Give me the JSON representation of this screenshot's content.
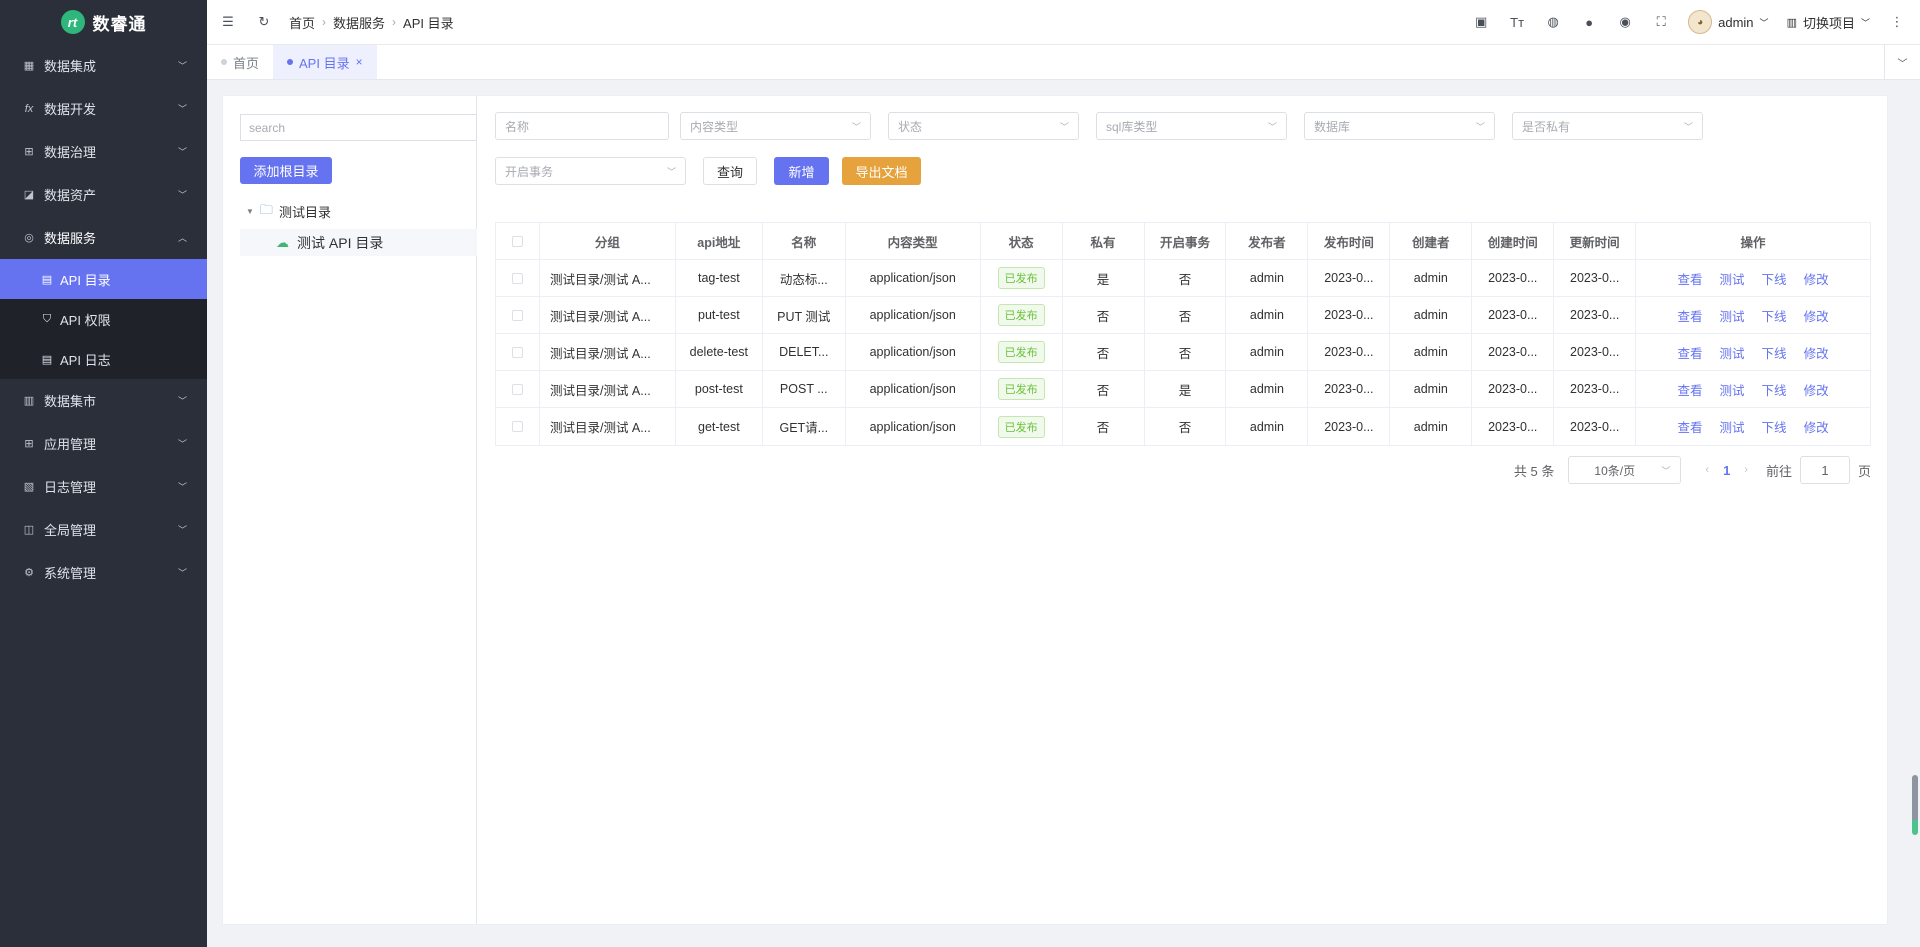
{
  "app": {
    "logo_mark": "rt",
    "name": "数睿通"
  },
  "sidebar": {
    "items": [
      {
        "label": "数据集成",
        "icon": "integration-icon"
      },
      {
        "label": "数据开发",
        "icon": "fx-icon"
      },
      {
        "label": "数据治理",
        "icon": "grid-icon"
      },
      {
        "label": "数据资产",
        "icon": "asset-icon"
      },
      {
        "label": "数据服务",
        "icon": "service-icon"
      },
      {
        "label": "数据集市",
        "icon": "market-icon"
      },
      {
        "label": "应用管理",
        "icon": "app-icon"
      },
      {
        "label": "日志管理",
        "icon": "log-icon"
      },
      {
        "label": "全局管理",
        "icon": "global-icon"
      },
      {
        "label": "系统管理",
        "icon": "gear-icon"
      }
    ],
    "sub_items": [
      {
        "label": "API 目录",
        "active": true
      },
      {
        "label": "API 权限",
        "active": false
      },
      {
        "label": "API 日志",
        "active": false
      }
    ]
  },
  "header": {
    "breadcrumb": [
      "首页",
      "数据服务",
      "API 目录"
    ],
    "user": "admin",
    "project_switch": "切换项目"
  },
  "tabs": [
    {
      "label": "首页",
      "active": false
    },
    {
      "label": "API 目录",
      "active": true,
      "close": "×"
    }
  ],
  "tree": {
    "search_placeholder": "search",
    "add_root_label": "添加根目录",
    "root": "测试目录",
    "child": "测试 API 目录"
  },
  "filters": {
    "name_placeholder": "名称",
    "content_type_placeholder": "内容类型",
    "status_placeholder": "状态",
    "sql_type_placeholder": "sql库类型",
    "database_placeholder": "数据库",
    "private_placeholder": "是否私有",
    "transaction_placeholder": "开启事务",
    "query_label": "查询",
    "new_label": "新增",
    "export_label": "导出文档"
  },
  "table": {
    "columns": [
      "分组",
      "api地址",
      "名称",
      "内容类型",
      "状态",
      "私有",
      "开启事务",
      "发布者",
      "发布时间",
      "创建者",
      "创建时间",
      "更新时间",
      "操作"
    ],
    "rows": [
      {
        "group": "测试目录/测试 A...",
        "path": "tag-test",
        "name": "动态标...",
        "content_type": "application/json",
        "status": "已发布",
        "private": "是",
        "transaction": "否",
        "publisher": "admin",
        "publish_time": "2023-0...",
        "creator": "admin",
        "create_time": "2023-0...",
        "update_time": "2023-0..."
      },
      {
        "group": "测试目录/测试 A...",
        "path": "put-test",
        "name": "PUT 测试",
        "content_type": "application/json",
        "status": "已发布",
        "private": "否",
        "transaction": "否",
        "publisher": "admin",
        "publish_time": "2023-0...",
        "creator": "admin",
        "create_time": "2023-0...",
        "update_time": "2023-0..."
      },
      {
        "group": "测试目录/测试 A...",
        "path": "delete-test",
        "name": "DELET...",
        "content_type": "application/json",
        "status": "已发布",
        "private": "否",
        "transaction": "否",
        "publisher": "admin",
        "publish_time": "2023-0...",
        "creator": "admin",
        "create_time": "2023-0...",
        "update_time": "2023-0..."
      },
      {
        "group": "测试目录/测试 A...",
        "path": "post-test",
        "name": "POST ...",
        "content_type": "application/json",
        "status": "已发布",
        "private": "否",
        "transaction": "是",
        "publisher": "admin",
        "publish_time": "2023-0...",
        "creator": "admin",
        "create_time": "2023-0...",
        "update_time": "2023-0..."
      },
      {
        "group": "测试目录/测试 A...",
        "path": "get-test",
        "name": "GET请...",
        "content_type": "application/json",
        "status": "已发布",
        "private": "否",
        "transaction": "否",
        "publisher": "admin",
        "publish_time": "2023-0...",
        "creator": "admin",
        "create_time": "2023-0...",
        "update_time": "2023-0..."
      }
    ],
    "actions": [
      "查看",
      "测试",
      "下线",
      "修改"
    ]
  },
  "pagination": {
    "total": "共 5 条",
    "page_size": "10条/页",
    "current": "1",
    "goto_prefix": "前往",
    "goto_value": "1",
    "goto_suffix": "页"
  },
  "colors": {
    "accent": "#6573f0",
    "sidebar_bg": "#2b2f3a",
    "export": "#e6a23c",
    "success": "#67c23a"
  }
}
